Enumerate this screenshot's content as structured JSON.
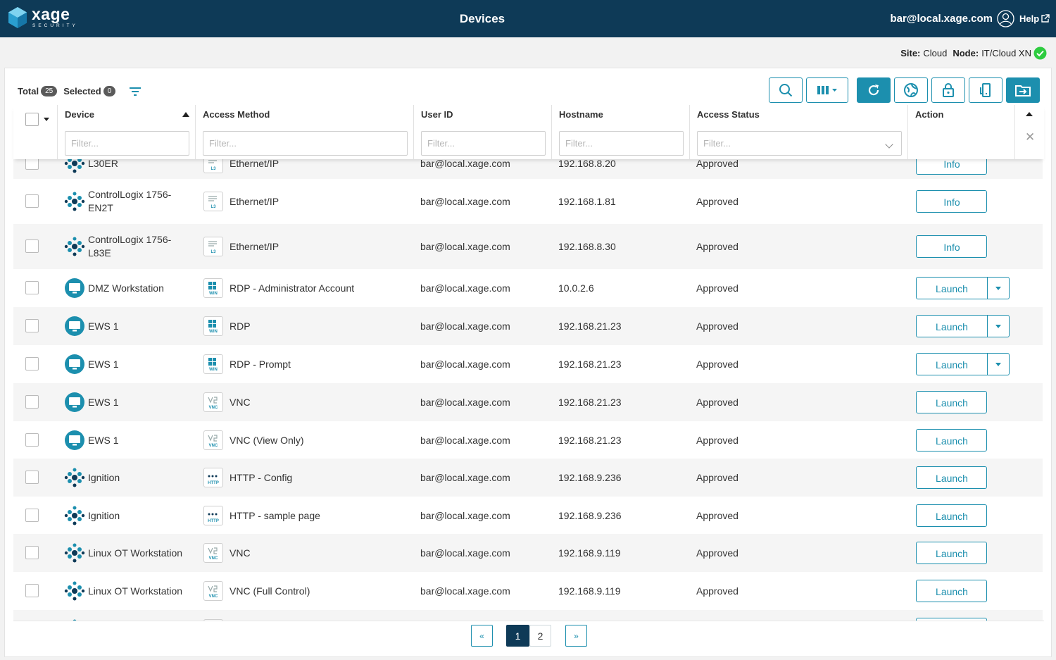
{
  "app": {
    "brand": "xage",
    "brand_sub": "SECURITY",
    "title": "Devices"
  },
  "user": {
    "email": "bar@local.xage.com",
    "help_label": "Help"
  },
  "site": {
    "site_label": "Site:",
    "site_value": "Cloud",
    "node_label": "Node:",
    "node_value": "IT/Cloud XN"
  },
  "summary": {
    "total_label": "Total",
    "total_count": "25",
    "selected_label": "Selected",
    "selected_count": "0"
  },
  "toolbar": {
    "buttons": [
      "search-icon",
      "columns-icon",
      "refresh-icon",
      "globe-icon",
      "lock-icon",
      "device-icon",
      "folder-export-icon"
    ]
  },
  "table": {
    "columns": [
      {
        "label": "Device",
        "filter": "Filter..."
      },
      {
        "label": "Access Method",
        "filter": "Filter..."
      },
      {
        "label": "User ID",
        "filter": "Filter..."
      },
      {
        "label": "Hostname",
        "filter": "Filter..."
      },
      {
        "label": "Access Status",
        "filter": "Filter..."
      },
      {
        "label": "Action"
      }
    ],
    "rows": [
      {
        "device": "L30ER",
        "icon": "plc",
        "method_tag": "L3",
        "method": "Ethernet/IP",
        "user": "bar@local.xage.com",
        "host": "192.168.8.20",
        "status": "Approved",
        "action": "Info",
        "split": false
      },
      {
        "device": "ControlLogix 1756-EN2T",
        "icon": "plc",
        "method_tag": "L3",
        "method": "Ethernet/IP",
        "user": "bar@local.xage.com",
        "host": "192.168.1.81",
        "status": "Approved",
        "action": "Info",
        "split": false
      },
      {
        "device": "ControlLogix 1756-L83E",
        "icon": "plc",
        "method_tag": "L3",
        "method": "Ethernet/IP",
        "user": "bar@local.xage.com",
        "host": "192.168.8.30",
        "status": "Approved",
        "action": "Info",
        "split": false
      },
      {
        "device": "DMZ Workstation",
        "icon": "monitor",
        "method_tag": "WIN",
        "method": "RDP - Administrator Account",
        "user": "bar@local.xage.com",
        "host": "10.0.2.6",
        "status": "Approved",
        "action": "Launch",
        "split": true
      },
      {
        "device": "EWS 1",
        "icon": "monitor",
        "method_tag": "WIN",
        "method": "RDP",
        "user": "bar@local.xage.com",
        "host": "192.168.21.23",
        "status": "Approved",
        "action": "Launch",
        "split": true
      },
      {
        "device": "EWS 1",
        "icon": "monitor",
        "method_tag": "WIN",
        "method": "RDP - Prompt",
        "user": "bar@local.xage.com",
        "host": "192.168.21.23",
        "status": "Approved",
        "action": "Launch",
        "split": true
      },
      {
        "device": "EWS 1",
        "icon": "monitor",
        "method_tag": "VNC",
        "method": "VNC",
        "user": "bar@local.xage.com",
        "host": "192.168.21.23",
        "status": "Approved",
        "action": "Launch",
        "split": false
      },
      {
        "device": "EWS 1",
        "icon": "monitor",
        "method_tag": "VNC",
        "method": "VNC (View Only)",
        "user": "bar@local.xage.com",
        "host": "192.168.21.23",
        "status": "Approved",
        "action": "Launch",
        "split": false
      },
      {
        "device": "Ignition",
        "icon": "plc",
        "method_tag": "HTTP",
        "method": "HTTP - Config",
        "user": "bar@local.xage.com",
        "host": "192.168.9.236",
        "status": "Approved",
        "action": "Launch",
        "split": false
      },
      {
        "device": "Ignition",
        "icon": "plc",
        "method_tag": "HTTP",
        "method": "HTTP - sample page",
        "user": "bar@local.xage.com",
        "host": "192.168.9.236",
        "status": "Approved",
        "action": "Launch",
        "split": false
      },
      {
        "device": "Linux OT Workstation",
        "icon": "plc",
        "method_tag": "VNC",
        "method": "VNC",
        "user": "bar@local.xage.com",
        "host": "192.168.9.119",
        "status": "Approved",
        "action": "Launch",
        "split": false
      },
      {
        "device": "Linux OT Workstation",
        "icon": "plc",
        "method_tag": "VNC",
        "method": "VNC (Full Control)",
        "user": "bar@local.xage.com",
        "host": "192.168.9.119",
        "status": "Approved",
        "action": "Launch",
        "split": false
      },
      {
        "device": "",
        "icon": "plc",
        "method_tag": "VNC",
        "method": "",
        "user": "",
        "host": "",
        "status": "",
        "action": "",
        "split": false
      }
    ]
  },
  "pagination": {
    "prev": "«",
    "pages": [
      "1",
      "2"
    ],
    "active": "1",
    "next": "»"
  },
  "colors": {
    "header_bg": "#0e3a57",
    "accent": "#1c8fae",
    "success": "#2ecc40"
  }
}
